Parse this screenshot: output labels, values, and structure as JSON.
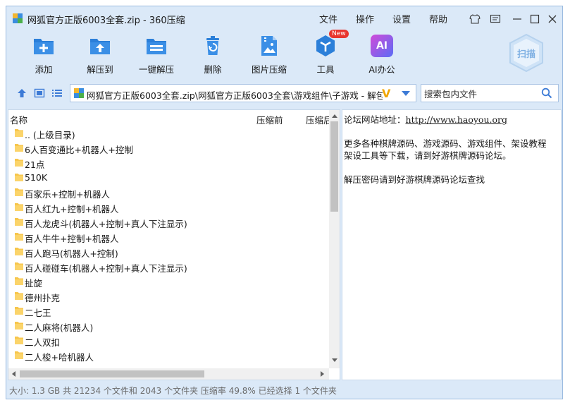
{
  "window": {
    "title": "网狐官方正版6003全套.zip - 360压缩",
    "menu": [
      "文件",
      "操作",
      "设置",
      "帮助"
    ]
  },
  "toolbar": {
    "items": [
      {
        "label": "添加",
        "icon": "add-icon"
      },
      {
        "label": "解压到",
        "icon": "extract-to-icon"
      },
      {
        "label": "一键解压",
        "icon": "one-click-extract-icon"
      },
      {
        "label": "删除",
        "icon": "delete-icon"
      },
      {
        "label": "图片压缩",
        "icon": "image-compress-icon"
      },
      {
        "label": "工具",
        "icon": "tools-icon"
      },
      {
        "label": "AI办公",
        "icon": "ai-office-icon"
      }
    ],
    "new_badge": "New",
    "ai_glyph": "AI",
    "scan_label": "扫描"
  },
  "address": {
    "path": "网狐官方正版6003全套.zip\\网狐官方正版6003全套\\游戏组件\\子游戏 - 解包大小",
    "v_mark": "V"
  },
  "search": {
    "placeholder": "搜索包内文件"
  },
  "columns": {
    "name": "名称",
    "before": "压缩前",
    "after": "压缩后"
  },
  "files": [
    ".. (上级目录)",
    "6人百变通比+机器人+控制",
    "21点",
    "510K",
    "百家乐+控制+机器人",
    "百人红九+控制+机器人",
    "百人龙虎斗(机器人+控制+真人下注显示)",
    "百人牛牛+控制+机器人",
    "百人跑马(机器人+控制)",
    "百人碰碰车(机器人+控制+真人下注显示)",
    "扯旋",
    "德州扑克",
    "二七王",
    "二人麻将(机器人)",
    "二人双扣",
    "二人梭+哈机器人"
  ],
  "comment": {
    "site_label": "论坛网站地址：",
    "site_url": "http://www.haoyou.org",
    "line2": "更多各种棋牌源码、游戏源码、游戏组件、架设教程",
    "line3": "架设工具等下载，请到好游棋牌源码论坛。",
    "line4": "解压密码请到好游棋牌源码论坛查找"
  },
  "status": {
    "text": "大小: 1.3 GB 共 21234 个文件和 2043 个文件夹 压缩率 49.8% 已经选择 1 个文件夹"
  },
  "colors": {
    "accent": "#2b7fd9",
    "folder": "#f7c64c",
    "window_bg": "#dbe9f8"
  }
}
